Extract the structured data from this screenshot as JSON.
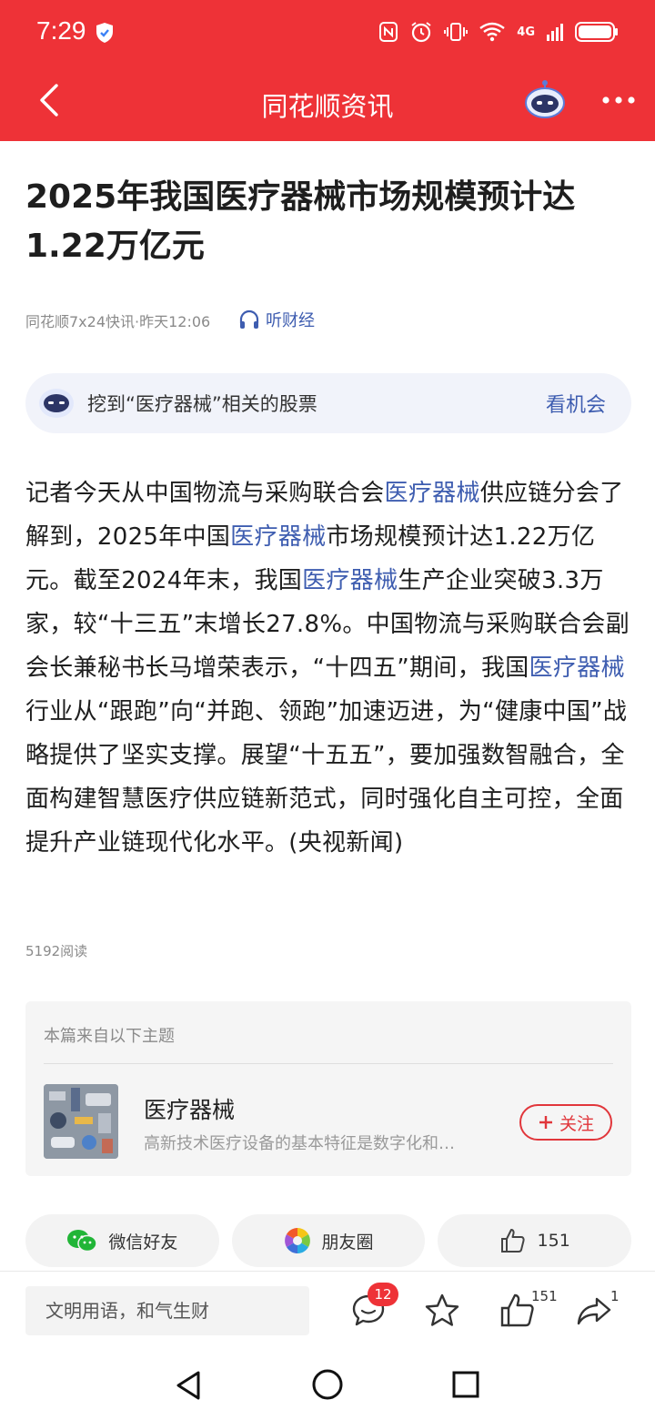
{
  "status_bar": {
    "time": "7:29",
    "network": "4G"
  },
  "header": {
    "title": "同花顺资讯"
  },
  "article": {
    "title": "2025年我国医疗器械市场规模预计达1.22万亿元",
    "meta": "同花顺7x24快讯·昨天12:06",
    "listen_label": "听财经",
    "body_segments": [
      {
        "text": "记者今天从中国物流与采购联合会",
        "kw": false
      },
      {
        "text": "医疗器械",
        "kw": true
      },
      {
        "text": "供应链分会了解到，2025年中国",
        "kw": false
      },
      {
        "text": "医疗器械",
        "kw": true
      },
      {
        "text": "市场规模预计达1.22万亿元。截至2024年末，我国",
        "kw": false
      },
      {
        "text": "医疗器械",
        "kw": true
      },
      {
        "text": "生产企业突破3.3万家，较“十三五”末增长27.8%。中国物流与采购联合会副会长兼秘书长马增荣表示，“十四五”期间，我国",
        "kw": false
      },
      {
        "text": "医疗器械",
        "kw": true
      },
      {
        "text": "行业从“跟跑”向“并跑、领跑”加速迈进，为“健康中国”战略提供了坚实支撑。展望“十五五”，要加强数智融合，全面构建智慧医疗供应链新范式，同时强化自主可控，全面提升产业链现代化水平。(央视新闻)",
        "kw": false
      }
    ],
    "reads": "5192阅读"
  },
  "dig": {
    "text": "挖到“医疗器械”相关的股票",
    "cta": "看机会"
  },
  "topic": {
    "label": "本篇来自以下主题",
    "name": "医疗器械",
    "description": "高新技术医疗设备的基本特征是数字化和…",
    "follow_label": "关注"
  },
  "share": {
    "wechat": "微信好友",
    "moments": "朋友圈",
    "like_count": "151"
  },
  "bottom_bar": {
    "comment_placeholder": "文明用语，和气生财",
    "comment_badge": "12",
    "like_count": "151",
    "share_count": "1"
  },
  "colors": {
    "brand_red": "#ee3237",
    "link_blue": "#3e5db0"
  }
}
